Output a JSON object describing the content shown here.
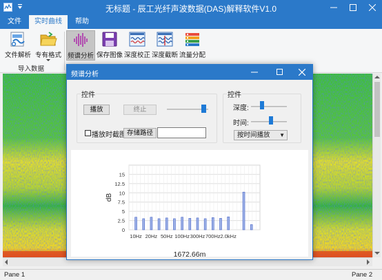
{
  "window": {
    "title": "无标题 - 辰工光纤声波数据(DAS)解释软件V1.0"
  },
  "tabs": [
    {
      "label": "文件",
      "active": false
    },
    {
      "label": "实时曲线",
      "active": true
    },
    {
      "label": "帮助",
      "active": false
    }
  ],
  "ribbon": {
    "group_import_label": "导入数据",
    "buttons": [
      {
        "label": "文件解析",
        "icon": "file-parse-icon",
        "selected": false
      },
      {
        "label": "专有格式",
        "icon": "folder-open-icon",
        "selected": false
      },
      {
        "label": "频谱分析",
        "icon": "spectrum-wave-icon",
        "selected": true
      },
      {
        "label": "保存图像",
        "icon": "floppy-disk-icon",
        "selected": false
      },
      {
        "label": "深度校正",
        "icon": "depth-calibrate-icon",
        "selected": false
      },
      {
        "label": "深度截断",
        "icon": "depth-cut-icon",
        "selected": false
      },
      {
        "label": "流量分配",
        "icon": "flow-bars-icon",
        "selected": false
      }
    ]
  },
  "statusbar": {
    "left": "Pane 1",
    "right": "Pane 2"
  },
  "dialog": {
    "title": "频谱分析",
    "group_left_title": "控件",
    "group_right_title": "控件",
    "play_button": "播放",
    "stop_button": "终止",
    "checkbox_label": "播放时截图",
    "save_path_button": "存储路径",
    "save_path_value": "",
    "depth_label": "深度:",
    "time_label": "时间:",
    "mode_select": "按时间播放",
    "depth_value_text": "1672.66m"
  },
  "colors": {
    "titlebar": "#2b79c9",
    "bar_fill": "#9db1e6",
    "bar_stroke": "#4a66c8",
    "slider_thumb": "#1e7ad6"
  },
  "chart_data": {
    "type": "bar",
    "ylabel": "dB",
    "ylim": [
      0,
      17.5
    ],
    "yticks": [
      0,
      2.5,
      5,
      7.5,
      10,
      12.5,
      15
    ],
    "x_tick_labels": [
      "10Hz",
      "20Hz",
      "50Hz",
      "100Hz",
      "300Hz",
      "700Hz",
      "2.0kHz"
    ],
    "values": [
      3.4,
      3.0,
      3.4,
      3.0,
      3.2,
      3.0,
      3.4,
      3.1,
      3.2,
      3.0,
      3.3,
      3.1,
      3.5,
      0,
      10.2,
      1.4
    ],
    "grid": true
  }
}
